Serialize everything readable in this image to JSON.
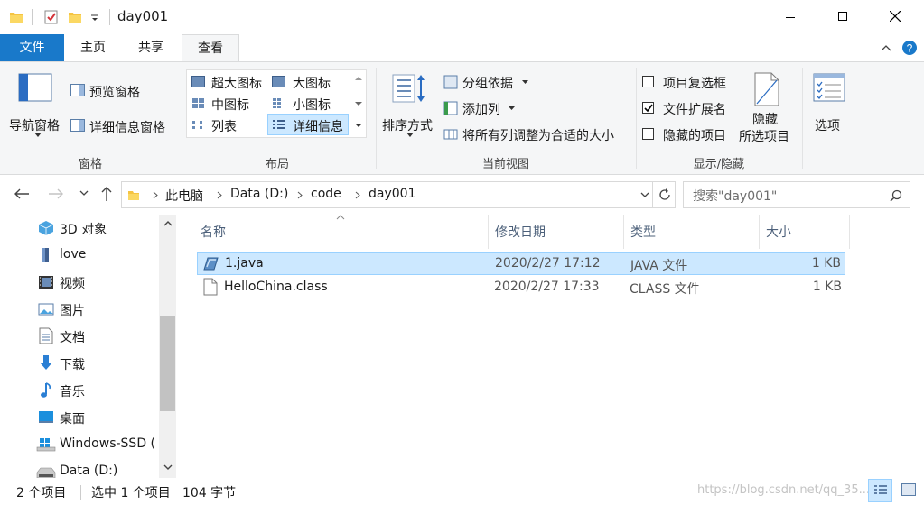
{
  "window": {
    "title": "day001"
  },
  "tabs": [
    {
      "label": "文件"
    },
    {
      "label": "主页"
    },
    {
      "label": "共享"
    },
    {
      "label": "查看"
    }
  ],
  "ribbon": {
    "panes": {
      "nav_pane": "导航窗格",
      "preview_pane": "预览窗格",
      "details_pane": "详细信息窗格",
      "group_label": "窗格"
    },
    "layout": {
      "xl_icons": "超大图标",
      "l_icons": "大图标",
      "m_icons": "中图标",
      "s_icons": "小图标",
      "list": "列表",
      "details": "详细信息",
      "group_label": "布局"
    },
    "current_view": {
      "sort_by": "排序方式",
      "group_by": "分组依据",
      "add_columns": "添加列",
      "size_all": "将所有列调整为合适的大小",
      "group_label": "当前视图"
    },
    "show_hide": {
      "item_checkboxes": "项目复选框",
      "file_ext": "文件扩展名",
      "hidden_items": "隐藏的项目",
      "hide_selected_1": "隐藏",
      "hide_selected_2": "所选项目",
      "group_label": "显示/隐藏",
      "item_checkboxes_checked": false,
      "file_ext_checked": true,
      "hidden_items_checked": false
    },
    "options": {
      "label": "选项"
    }
  },
  "address": {
    "crumbs": [
      "此电脑",
      "Data (D:)",
      "code",
      "day001"
    ],
    "search_placeholder": "搜索\"day001\""
  },
  "sidebar": {
    "items": [
      {
        "label": "3D 对象",
        "icon": "3d-objects-icon"
      },
      {
        "label": "love",
        "icon": "folder-icon"
      },
      {
        "label": "视频",
        "icon": "video-icon"
      },
      {
        "label": "图片",
        "icon": "pictures-icon"
      },
      {
        "label": "文档",
        "icon": "documents-icon"
      },
      {
        "label": "下载",
        "icon": "download-icon"
      },
      {
        "label": "音乐",
        "icon": "music-icon"
      },
      {
        "label": "桌面",
        "icon": "desktop-icon"
      },
      {
        "label": "Windows-SSD (",
        "icon": "drive-icon"
      },
      {
        "label": "Data (D:)",
        "icon": "drive-icon"
      }
    ]
  },
  "columns": {
    "name": "名称",
    "modified": "修改日期",
    "type": "类型",
    "size": "大小"
  },
  "files": [
    {
      "name": "1.java",
      "modified": "2020/2/27 17:12",
      "type": "JAVA 文件",
      "size": "1 KB",
      "selected": true
    },
    {
      "name": "HelloChina.class",
      "modified": "2020/2/27 17:33",
      "type": "CLASS 文件",
      "size": "1 KB",
      "selected": false
    }
  ],
  "status": {
    "count": "2 个项目",
    "selection": "选中 1 个项目",
    "bytes": "104 字节"
  },
  "watermark": "https://blog.csdn.net/qq_35...",
  "colors": {
    "accent": "#1979ca",
    "selected_row": "#cce8ff",
    "selected_border": "#99d1ff"
  }
}
